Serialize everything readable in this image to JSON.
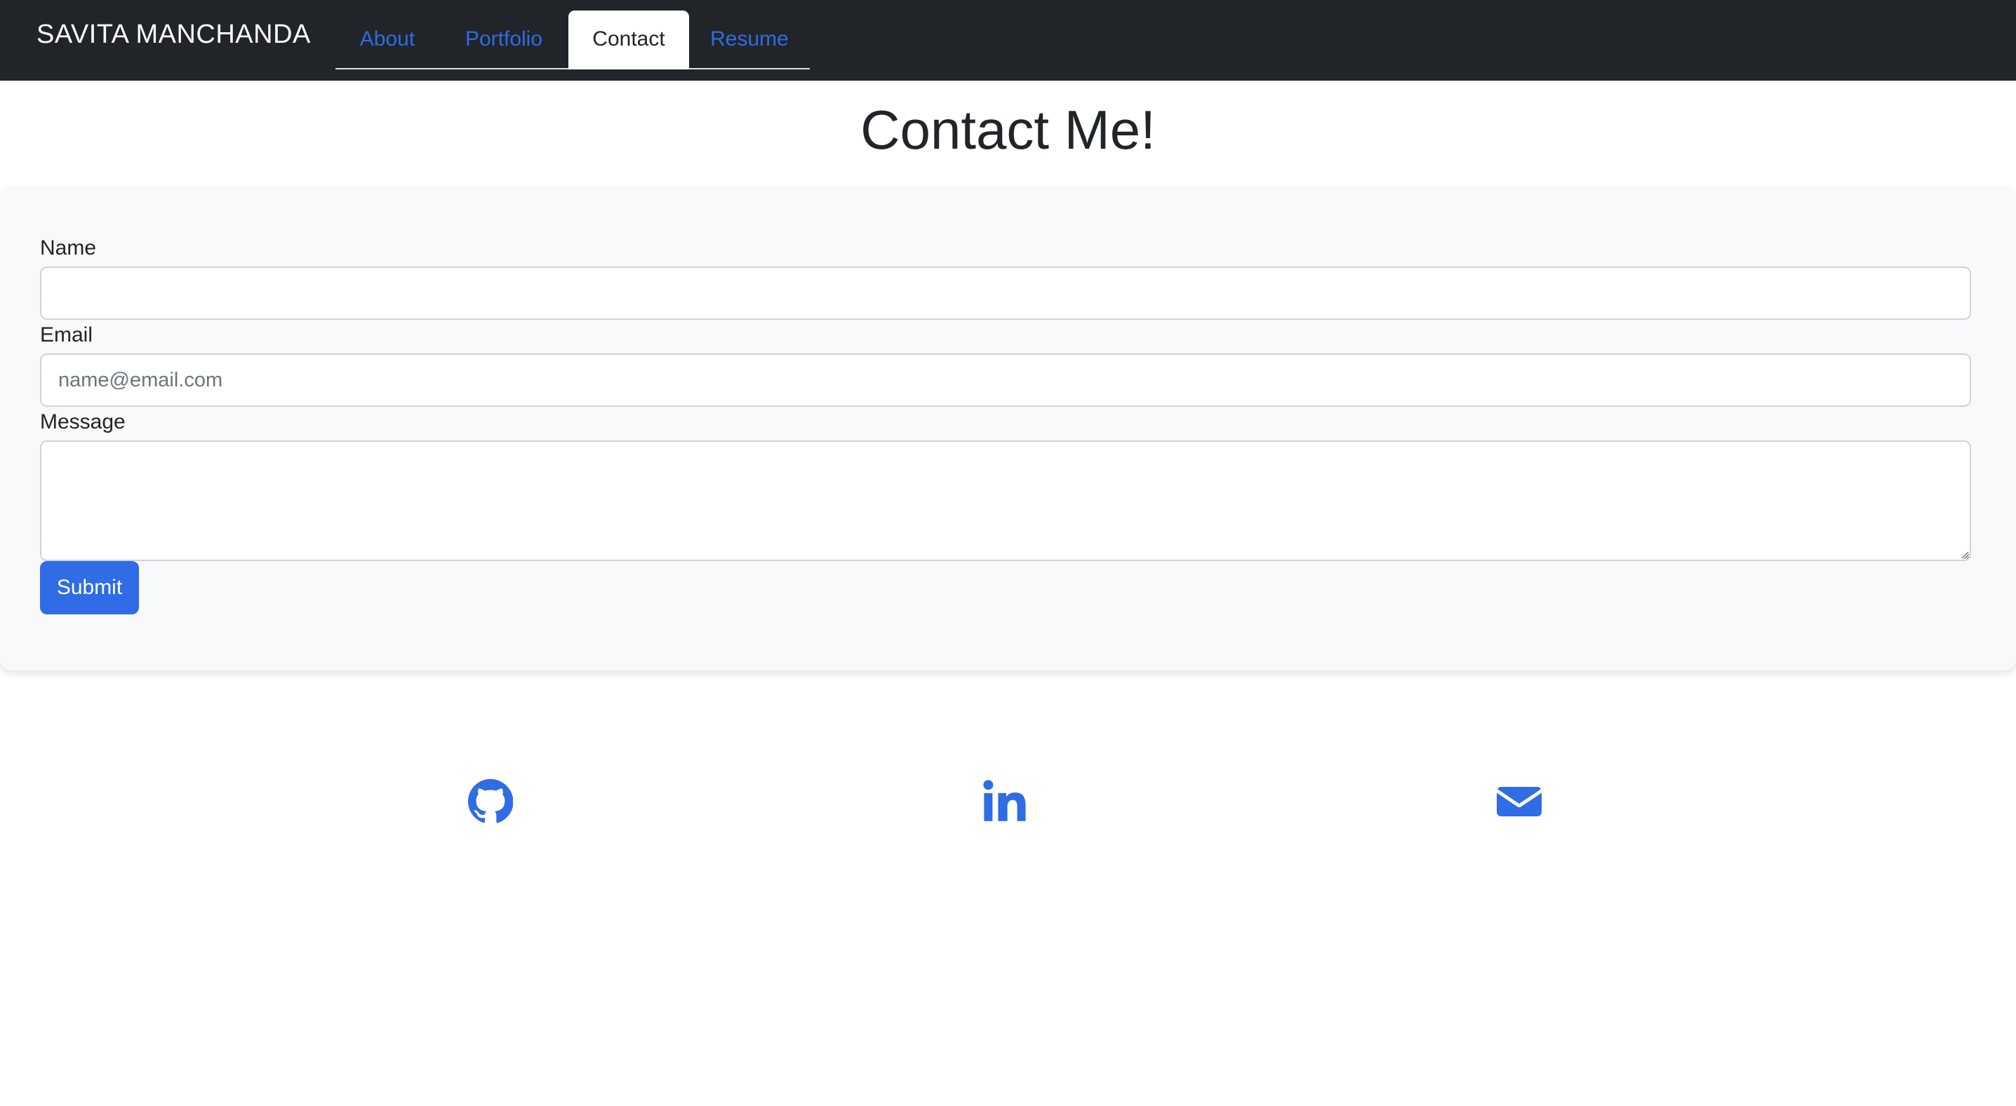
{
  "navbar": {
    "brand": "SAVITA MANCHANDA",
    "tabs": [
      {
        "label": "About",
        "active": false
      },
      {
        "label": "Portfolio",
        "active": false
      },
      {
        "label": "Contact",
        "active": true
      },
      {
        "label": "Resume",
        "active": false
      }
    ]
  },
  "main": {
    "title": "Contact Me!"
  },
  "form": {
    "name_label": "Name",
    "name_value": "",
    "email_label": "Email",
    "email_placeholder": "name@email.com",
    "email_value": "",
    "message_label": "Message",
    "message_value": "",
    "submit_label": "Submit"
  },
  "social": {
    "icons": [
      "github-icon",
      "linkedin-icon",
      "envelope-icon"
    ]
  },
  "colors": {
    "navbar_bg": "#212529",
    "accent": "#2f6ce5",
    "card_bg": "#f8f9fa"
  }
}
